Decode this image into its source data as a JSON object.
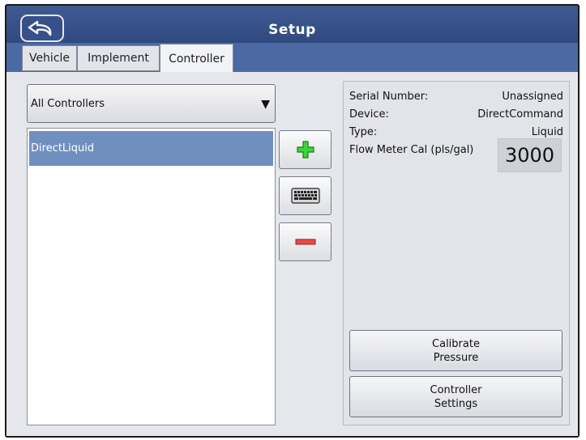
{
  "header": {
    "title": "Setup"
  },
  "tabs": [
    {
      "label": "Vehicle"
    },
    {
      "label": "Implement"
    },
    {
      "label": "Controller"
    }
  ],
  "active_tab": "Controller",
  "filter": {
    "selected": "All Controllers"
  },
  "controllers": [
    {
      "label": "DirectLiquid"
    }
  ],
  "details": {
    "serial_number_label": "Serial Number:",
    "serial_number_value": "Unassigned",
    "device_label": "Device:",
    "device_value": "DirectCommand",
    "type_label": "Type:",
    "type_value": "Liquid",
    "flow_meter_label": "Flow Meter Cal (pls/gal)",
    "flow_meter_value": "3000"
  },
  "buttons": {
    "calibrate_line1": "Calibrate",
    "calibrate_line2": "Pressure",
    "settings_line1": "Controller",
    "settings_line2": "Settings"
  },
  "icons": {
    "back": "back-arrow-icon",
    "add": "plus-icon",
    "edit": "keyboard-icon",
    "remove": "minus-icon"
  },
  "colors": {
    "header": "#3f5b92",
    "selected_row": "#6f90bf",
    "add_icon": "#33cc33",
    "remove_icon": "#e04040"
  }
}
